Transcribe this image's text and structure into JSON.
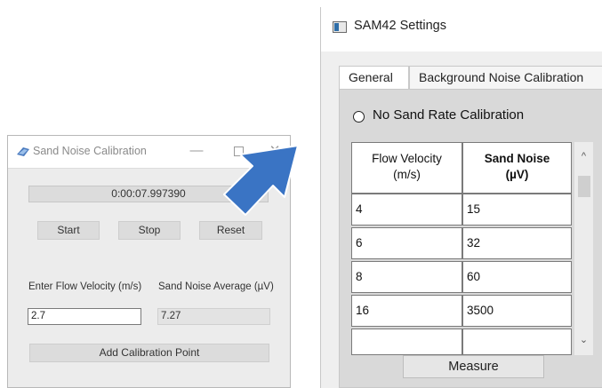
{
  "sand_noise_window": {
    "title": "Sand Noise Calibration",
    "minimize_glyph": "—",
    "close_glyph": "✕",
    "timer": "0:00:07.997390",
    "buttons": {
      "start": "Start",
      "stop": "Stop",
      "reset": "Reset"
    },
    "flow_label": "Enter Flow Velocity (m/s)",
    "sand_label": "Sand Noise Average (µV)",
    "flow_value": "2.7",
    "sand_value": "7.27",
    "add_button": "Add Calibration Point"
  },
  "settings_window": {
    "title": "SAM42 Settings",
    "tabs": [
      "General",
      "Background Noise Calibration"
    ],
    "radio_label": "No Sand Rate Calibration",
    "columns": {
      "flow": {
        "line1": "Flow Velocity",
        "line2": "(m/s)"
      },
      "sand": {
        "line1": "Sand Noise",
        "line2": "(µV)"
      }
    },
    "rows": [
      {
        "flow": "4",
        "sand": "15"
      },
      {
        "flow": "6",
        "sand": "32"
      },
      {
        "flow": "8",
        "sand": "60"
      },
      {
        "flow": "16",
        "sand": "3500"
      },
      {
        "flow": "",
        "sand": ""
      }
    ],
    "measure_button": "Measure"
  },
  "icons": {
    "scroll_up": "^",
    "scroll_down": "⌄"
  },
  "colors": {
    "arrow": "#3a74c4",
    "window_bg": "#ececec",
    "panel_bg": "#d9d9d9"
  }
}
